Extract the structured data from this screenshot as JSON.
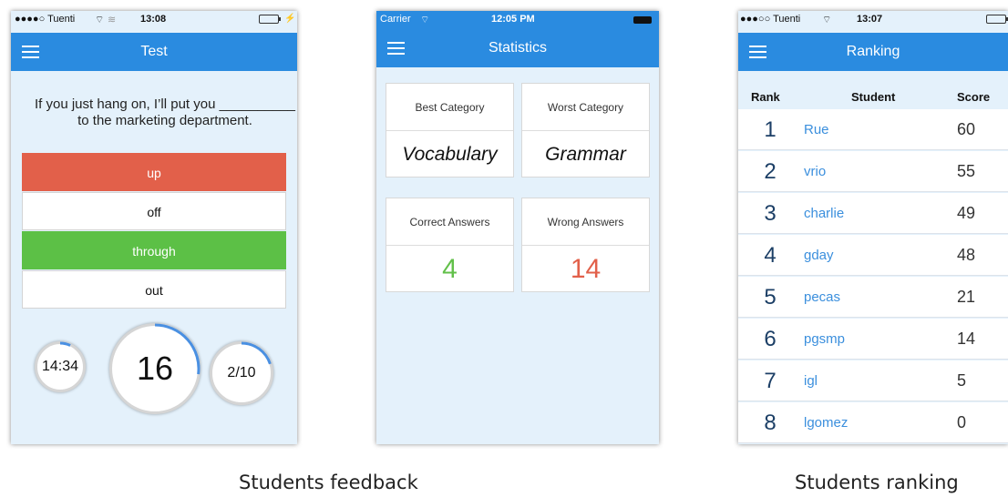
{
  "feedback_screen": {
    "status": {
      "carrier": "●●●●○ Tuenti",
      "signal": "≋",
      "time": "13:08"
    },
    "nav": {
      "title": "Test"
    },
    "question": "If you just hang on, I’ll put you __________ to the marketing department.",
    "options": [
      {
        "label": "up",
        "state": "wrong",
        "color": "#e2604a"
      },
      {
        "label": "off",
        "state": "neutral",
        "color": "#ffffff"
      },
      {
        "label": "through",
        "state": "correct",
        "color": "#5cc046"
      },
      {
        "label": "out",
        "state": "neutral",
        "color": "#ffffff"
      }
    ],
    "timer": {
      "value": "14:34",
      "progress": 0.07
    },
    "countdown": {
      "value": "16",
      "progress": 0.27
    },
    "question_counter": {
      "value": "2/10",
      "progress": 0.2
    }
  },
  "statistics_screen": {
    "status": {
      "carrier": "Carrier",
      "time": "12:05 PM"
    },
    "nav": {
      "title": "Statistics"
    },
    "cards": [
      {
        "label": "Best Category",
        "value": "Vocabulary",
        "value_color": "#111111"
      },
      {
        "label": "Worst Category",
        "value": "Grammar",
        "value_color": "#111111"
      },
      {
        "label": "Correct Answers",
        "value": "4",
        "value_color": "#62c04a"
      },
      {
        "label": "Wrong Answers",
        "value": "14",
        "value_color": "#e2604a"
      }
    ]
  },
  "ranking_screen": {
    "status": {
      "carrier": "●●●○○ Tuenti",
      "time": "13:07"
    },
    "nav": {
      "title": "Ranking"
    },
    "columns": {
      "rank": "Rank",
      "student": "Student",
      "score": "Score"
    },
    "rows": [
      {
        "rank": "1",
        "student": "Rue",
        "score": "60"
      },
      {
        "rank": "2",
        "student": "vrio",
        "score": "55"
      },
      {
        "rank": "3",
        "student": "charlie",
        "score": "49"
      },
      {
        "rank": "4",
        "student": "gday",
        "score": "48"
      },
      {
        "rank": "5",
        "student": "pecas",
        "score": "21"
      },
      {
        "rank": "6",
        "student": "pgsmp",
        "score": "14"
      },
      {
        "rank": "7",
        "student": "igl",
        "score": "5"
      },
      {
        "rank": "8",
        "student": "lgomez",
        "score": "0"
      }
    ]
  },
  "captions": {
    "feedback": "Students feedback",
    "ranking": "Students ranking"
  },
  "colors": {
    "nav_blue": "#2a8be0",
    "screen_bg": "#e4f1fb",
    "progress_arc": "#4a90e2"
  }
}
